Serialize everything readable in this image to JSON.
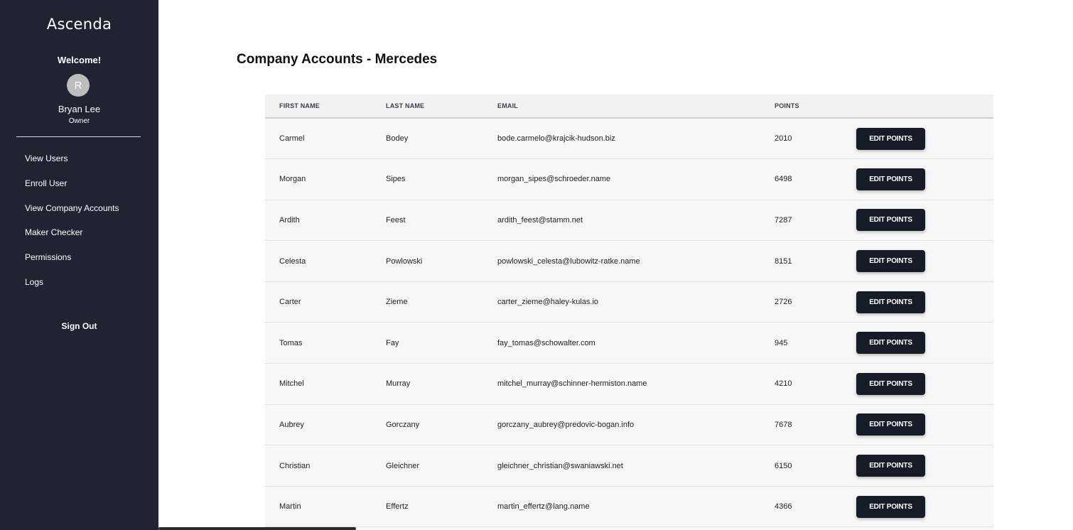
{
  "sidebar": {
    "logo": "Ascenda",
    "welcome": "Welcome!",
    "avatar_initial": "R",
    "user_name": "Bryan Lee",
    "user_role": "Owner",
    "nav_items": [
      {
        "label": "View Users"
      },
      {
        "label": "Enroll User"
      },
      {
        "label": "View Company Accounts"
      },
      {
        "label": "Maker Checker"
      },
      {
        "label": "Permissions"
      },
      {
        "label": "Logs"
      }
    ],
    "sign_out": "Sign Out",
    "bg_color": "#1f2433"
  },
  "main": {
    "title": "Company Accounts - Mercedes",
    "table": {
      "columns": [
        "FIRST NAME",
        "LAST NAME",
        "EMAIL",
        "POINTS",
        ""
      ],
      "action_label": "EDIT POINTS",
      "rows": [
        {
          "first": "Carmel",
          "last": "Bodey",
          "email": "bode.carmelo@krajcik-hudson.biz",
          "points": "2010"
        },
        {
          "first": "Morgan",
          "last": "Sipes",
          "email": "morgan_sipes@schroeder.name",
          "points": "6498"
        },
        {
          "first": "Ardith",
          "last": "Feest",
          "email": "ardith_feest@stamm.net",
          "points": "7287"
        },
        {
          "first": "Celesta",
          "last": "Powlowski",
          "email": "powlowski_celesta@lubowitz-ratke.name",
          "points": "8151"
        },
        {
          "first": "Carter",
          "last": "Zieme",
          "email": "carter_zieme@haley-kulas.io",
          "points": "2726"
        },
        {
          "first": "Tomas",
          "last": "Fay",
          "email": "fay_tomas@schowalter.com",
          "points": "945"
        },
        {
          "first": "Mitchel",
          "last": "Murray",
          "email": "mitchel_murray@schinner-hermiston.name",
          "points": "4210"
        },
        {
          "first": "Aubrey",
          "last": "Gorczany",
          "email": "gorczany_aubrey@predovic-bogan.info",
          "points": "7678"
        },
        {
          "first": "Christian",
          "last": "Gleichner",
          "email": "gleichner_christian@swaniawski.net",
          "points": "6150"
        },
        {
          "first": "Martin",
          "last": "Effertz",
          "email": "martin_effertz@lang.name",
          "points": "4366"
        }
      ]
    }
  }
}
